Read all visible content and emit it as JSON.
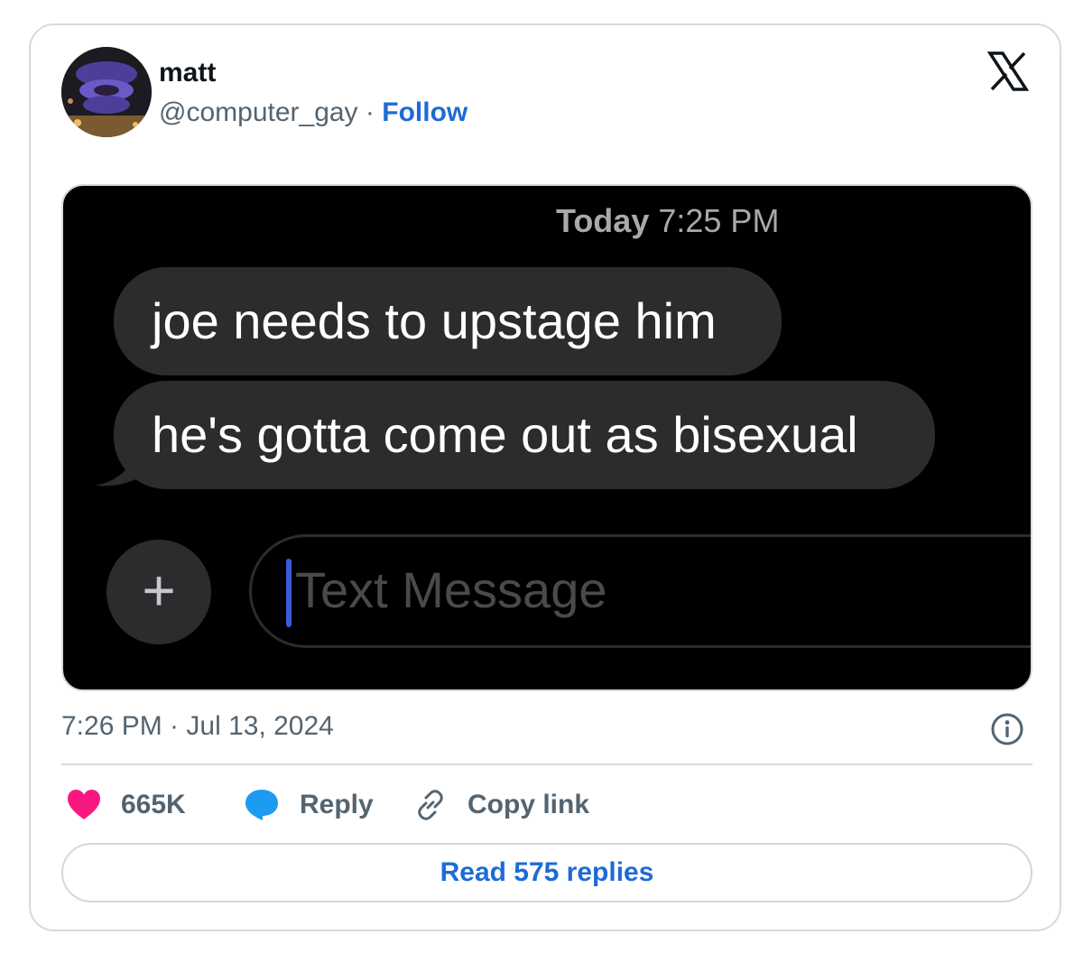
{
  "author": {
    "display_name": "matt",
    "handle": "@computer_gay",
    "separator": "·",
    "follow_label": "Follow"
  },
  "media": {
    "conversation_time_day": "Today",
    "conversation_time": "7:25 PM",
    "messages": [
      "joe needs to upstage him",
      "he's gotta come out as bisexual"
    ],
    "add_button_glyph": "+",
    "input_placeholder": "Text Message"
  },
  "timestamp": "7:26 PM · Jul 13, 2024",
  "actions": {
    "like_count": "665K",
    "reply_label": "Reply",
    "copy_label": "Copy link"
  },
  "read_replies_label": "Read 575 replies",
  "colors": {
    "like": "#f91880",
    "reply": "#1d9bf0",
    "link": "#1d6bd6",
    "bubble": "#2c2c2e"
  },
  "icons": {
    "logo": "x-logo-icon",
    "info": "info-icon",
    "like": "heart-icon",
    "reply": "speech-bubble-icon",
    "copy": "link-icon"
  }
}
